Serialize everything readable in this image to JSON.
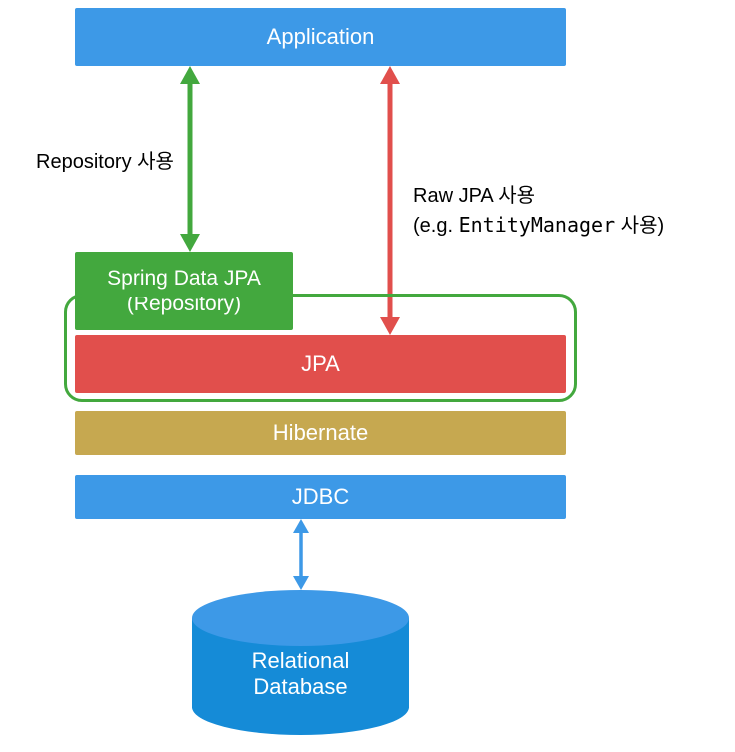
{
  "boxes": {
    "application": "Application",
    "spring_data_jpa_line1": "Spring Data JPA",
    "spring_data_jpa_line2": "(Repository)",
    "jpa": "JPA",
    "hibernate": "Hibernate",
    "jdbc": "JDBC"
  },
  "database": {
    "line1": "Relational",
    "line2": "Database"
  },
  "labels": {
    "repository": "Repository 사용",
    "raw_jpa_line1": "Raw JPA 사용",
    "raw_jpa_line2_pre": "(e.g. ",
    "raw_jpa_line2_code": "EntityManager",
    "raw_jpa_line2_post": " 사용)"
  },
  "colors": {
    "blue": "#3d99e7",
    "green": "#43a83e",
    "red": "#e14f4c",
    "gold": "#c6a850",
    "db_blue": "#158bd7"
  },
  "arrows": [
    {
      "name": "application-to-springdatajpa",
      "direction": "bidirectional-vertical",
      "color": "green"
    },
    {
      "name": "application-to-jpa",
      "direction": "bidirectional-vertical",
      "color": "red"
    },
    {
      "name": "jdbc-to-database",
      "direction": "bidirectional-vertical",
      "color": "blue"
    }
  ]
}
